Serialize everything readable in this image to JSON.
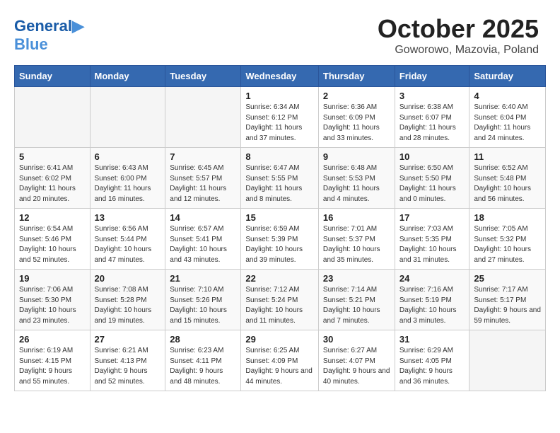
{
  "header": {
    "title": "October 2025",
    "subtitle": "Goworowo, Mazovia, Poland",
    "logo_line1": "General",
    "logo_line2": "Blue"
  },
  "days_of_week": [
    "Sunday",
    "Monday",
    "Tuesday",
    "Wednesday",
    "Thursday",
    "Friday",
    "Saturday"
  ],
  "weeks": [
    [
      {
        "day": "",
        "empty": true
      },
      {
        "day": "",
        "empty": true
      },
      {
        "day": "",
        "empty": true
      },
      {
        "day": "1",
        "sunrise": "6:34 AM",
        "sunset": "6:12 PM",
        "daylight": "11 hours and 37 minutes."
      },
      {
        "day": "2",
        "sunrise": "6:36 AM",
        "sunset": "6:09 PM",
        "daylight": "11 hours and 33 minutes."
      },
      {
        "day": "3",
        "sunrise": "6:38 AM",
        "sunset": "6:07 PM",
        "daylight": "11 hours and 28 minutes."
      },
      {
        "day": "4",
        "sunrise": "6:40 AM",
        "sunset": "6:04 PM",
        "daylight": "11 hours and 24 minutes."
      }
    ],
    [
      {
        "day": "5",
        "sunrise": "6:41 AM",
        "sunset": "6:02 PM",
        "daylight": "11 hours and 20 minutes."
      },
      {
        "day": "6",
        "sunrise": "6:43 AM",
        "sunset": "6:00 PM",
        "daylight": "11 hours and 16 minutes."
      },
      {
        "day": "7",
        "sunrise": "6:45 AM",
        "sunset": "5:57 PM",
        "daylight": "11 hours and 12 minutes."
      },
      {
        "day": "8",
        "sunrise": "6:47 AM",
        "sunset": "5:55 PM",
        "daylight": "11 hours and 8 minutes."
      },
      {
        "day": "9",
        "sunrise": "6:48 AM",
        "sunset": "5:53 PM",
        "daylight": "11 hours and 4 minutes."
      },
      {
        "day": "10",
        "sunrise": "6:50 AM",
        "sunset": "5:50 PM",
        "daylight": "11 hours and 0 minutes."
      },
      {
        "day": "11",
        "sunrise": "6:52 AM",
        "sunset": "5:48 PM",
        "daylight": "10 hours and 56 minutes."
      }
    ],
    [
      {
        "day": "12",
        "sunrise": "6:54 AM",
        "sunset": "5:46 PM",
        "daylight": "10 hours and 52 minutes."
      },
      {
        "day": "13",
        "sunrise": "6:56 AM",
        "sunset": "5:44 PM",
        "daylight": "10 hours and 47 minutes."
      },
      {
        "day": "14",
        "sunrise": "6:57 AM",
        "sunset": "5:41 PM",
        "daylight": "10 hours and 43 minutes."
      },
      {
        "day": "15",
        "sunrise": "6:59 AM",
        "sunset": "5:39 PM",
        "daylight": "10 hours and 39 minutes."
      },
      {
        "day": "16",
        "sunrise": "7:01 AM",
        "sunset": "5:37 PM",
        "daylight": "10 hours and 35 minutes."
      },
      {
        "day": "17",
        "sunrise": "7:03 AM",
        "sunset": "5:35 PM",
        "daylight": "10 hours and 31 minutes."
      },
      {
        "day": "18",
        "sunrise": "7:05 AM",
        "sunset": "5:32 PM",
        "daylight": "10 hours and 27 minutes."
      }
    ],
    [
      {
        "day": "19",
        "sunrise": "7:06 AM",
        "sunset": "5:30 PM",
        "daylight": "10 hours and 23 minutes."
      },
      {
        "day": "20",
        "sunrise": "7:08 AM",
        "sunset": "5:28 PM",
        "daylight": "10 hours and 19 minutes."
      },
      {
        "day": "21",
        "sunrise": "7:10 AM",
        "sunset": "5:26 PM",
        "daylight": "10 hours and 15 minutes."
      },
      {
        "day": "22",
        "sunrise": "7:12 AM",
        "sunset": "5:24 PM",
        "daylight": "10 hours and 11 minutes."
      },
      {
        "day": "23",
        "sunrise": "7:14 AM",
        "sunset": "5:21 PM",
        "daylight": "10 hours and 7 minutes."
      },
      {
        "day": "24",
        "sunrise": "7:16 AM",
        "sunset": "5:19 PM",
        "daylight": "10 hours and 3 minutes."
      },
      {
        "day": "25",
        "sunrise": "7:17 AM",
        "sunset": "5:17 PM",
        "daylight": "9 hours and 59 minutes."
      }
    ],
    [
      {
        "day": "26",
        "sunrise": "6:19 AM",
        "sunset": "4:15 PM",
        "daylight": "9 hours and 55 minutes."
      },
      {
        "day": "27",
        "sunrise": "6:21 AM",
        "sunset": "4:13 PM",
        "daylight": "9 hours and 52 minutes."
      },
      {
        "day": "28",
        "sunrise": "6:23 AM",
        "sunset": "4:11 PM",
        "daylight": "9 hours and 48 minutes."
      },
      {
        "day": "29",
        "sunrise": "6:25 AM",
        "sunset": "4:09 PM",
        "daylight": "9 hours and 44 minutes."
      },
      {
        "day": "30",
        "sunrise": "6:27 AM",
        "sunset": "4:07 PM",
        "daylight": "9 hours and 40 minutes."
      },
      {
        "day": "31",
        "sunrise": "6:29 AM",
        "sunset": "4:05 PM",
        "daylight": "9 hours and 36 minutes."
      },
      {
        "day": "",
        "empty": true
      }
    ]
  ],
  "labels": {
    "sunrise_prefix": "Sunrise:",
    "sunset_prefix": "Sunset:",
    "daylight_prefix": "Daylight:"
  }
}
